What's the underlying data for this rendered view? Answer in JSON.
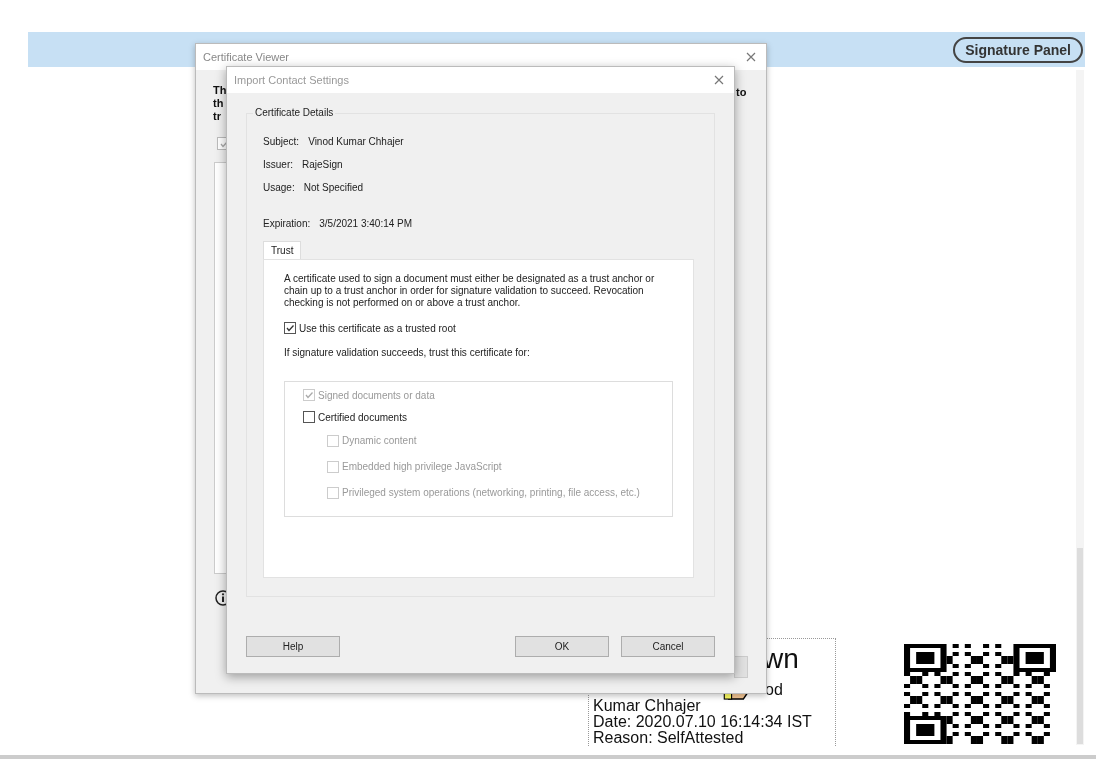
{
  "toolbar": {
    "signature_panel_button": "Signature Panel"
  },
  "certificate_viewer": {
    "title": "Certificate Viewer",
    "intro_left": [
      "Th",
      "th",
      "tr"
    ],
    "intro_right": "to",
    "checkbox_checked": true
  },
  "dialog": {
    "title": "Import Contact Settings",
    "group_title": "Certificate Details",
    "details": [
      {
        "label": "Subject:",
        "value": "Vinod Kumar Chhajer"
      },
      {
        "label": "Issuer:",
        "value": "RajeSign"
      },
      {
        "label": "Usage:",
        "value": "Not Specified"
      }
    ],
    "expiration": {
      "label": "Expiration:",
      "value": "3/5/2021 3:40:14 PM"
    },
    "tabs": [
      {
        "label": "Trust",
        "selected": true
      }
    ],
    "description": "A certificate used to sign a document must either be designated as a trust anchor or chain up to a trust anchor in order for signature validation to succeed.  Revocation checking is not performed on or above a trust anchor.",
    "trusted_root": {
      "label": "Use this certificate as a trusted root",
      "checked": true
    },
    "trust_for_label": "If signature validation succeeds, trust this certificate for:",
    "trust_options": [
      {
        "label": "Signed documents or data",
        "checked": true,
        "disabled": true
      },
      {
        "label": "Certified documents",
        "checked": false,
        "disabled": false,
        "children": [
          {
            "label": "Dynamic content",
            "checked": false,
            "disabled": true
          },
          {
            "label": "Embedded high privilege JavaScript",
            "checked": false,
            "disabled": true
          },
          {
            "label": "Privileged system operations (networking, printing, file access, etc.)",
            "checked": false,
            "disabled": true
          }
        ]
      }
    ],
    "buttons": [
      {
        "label": "Help",
        "kind": "left"
      },
      {
        "label": "OK",
        "kind": "right"
      },
      {
        "label": "Cancel",
        "kind": "right"
      }
    ]
  },
  "signature": {
    "lines": [
      {
        "text": "wn",
        "kind": "heading"
      },
      {
        "text": "od",
        "kind": "text"
      },
      {
        "text": "Kumar Chhajer",
        "kind": "text"
      },
      {
        "text": "Date: 2020.07.10 16:14:34 IST",
        "kind": "text"
      },
      {
        "text": "Reason: SelfAttested",
        "kind": "text"
      }
    ]
  }
}
